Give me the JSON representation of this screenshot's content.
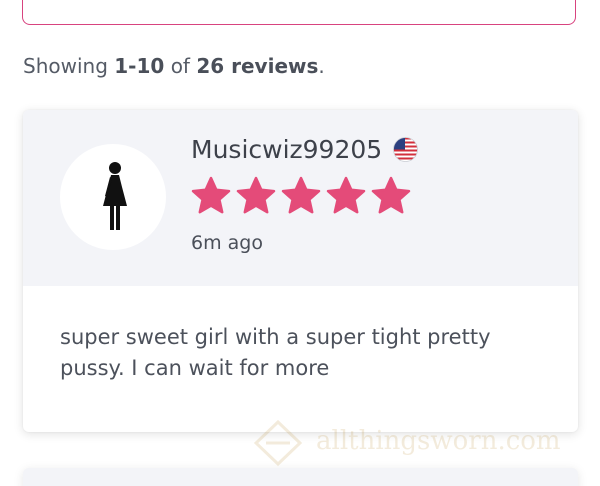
{
  "summary": {
    "prefix": "Showing",
    "range": "1-10",
    "of": "of",
    "count": "26 reviews",
    "suffix": "."
  },
  "review": {
    "username": "Musicwiz99205",
    "flag_icon": "us-flag-icon",
    "avatar_icon": "female-figure-icon",
    "rating": 5,
    "rating_max": 5,
    "star_color": "#e44b79",
    "time_ago": "6m ago",
    "body": "super sweet girl with a super tight pretty pussy. I can wait for more"
  },
  "watermark": {
    "text": "allthingsworn.com"
  },
  "colors": {
    "accent": "#d8437f",
    "header_bg": "#f3f4f8"
  }
}
